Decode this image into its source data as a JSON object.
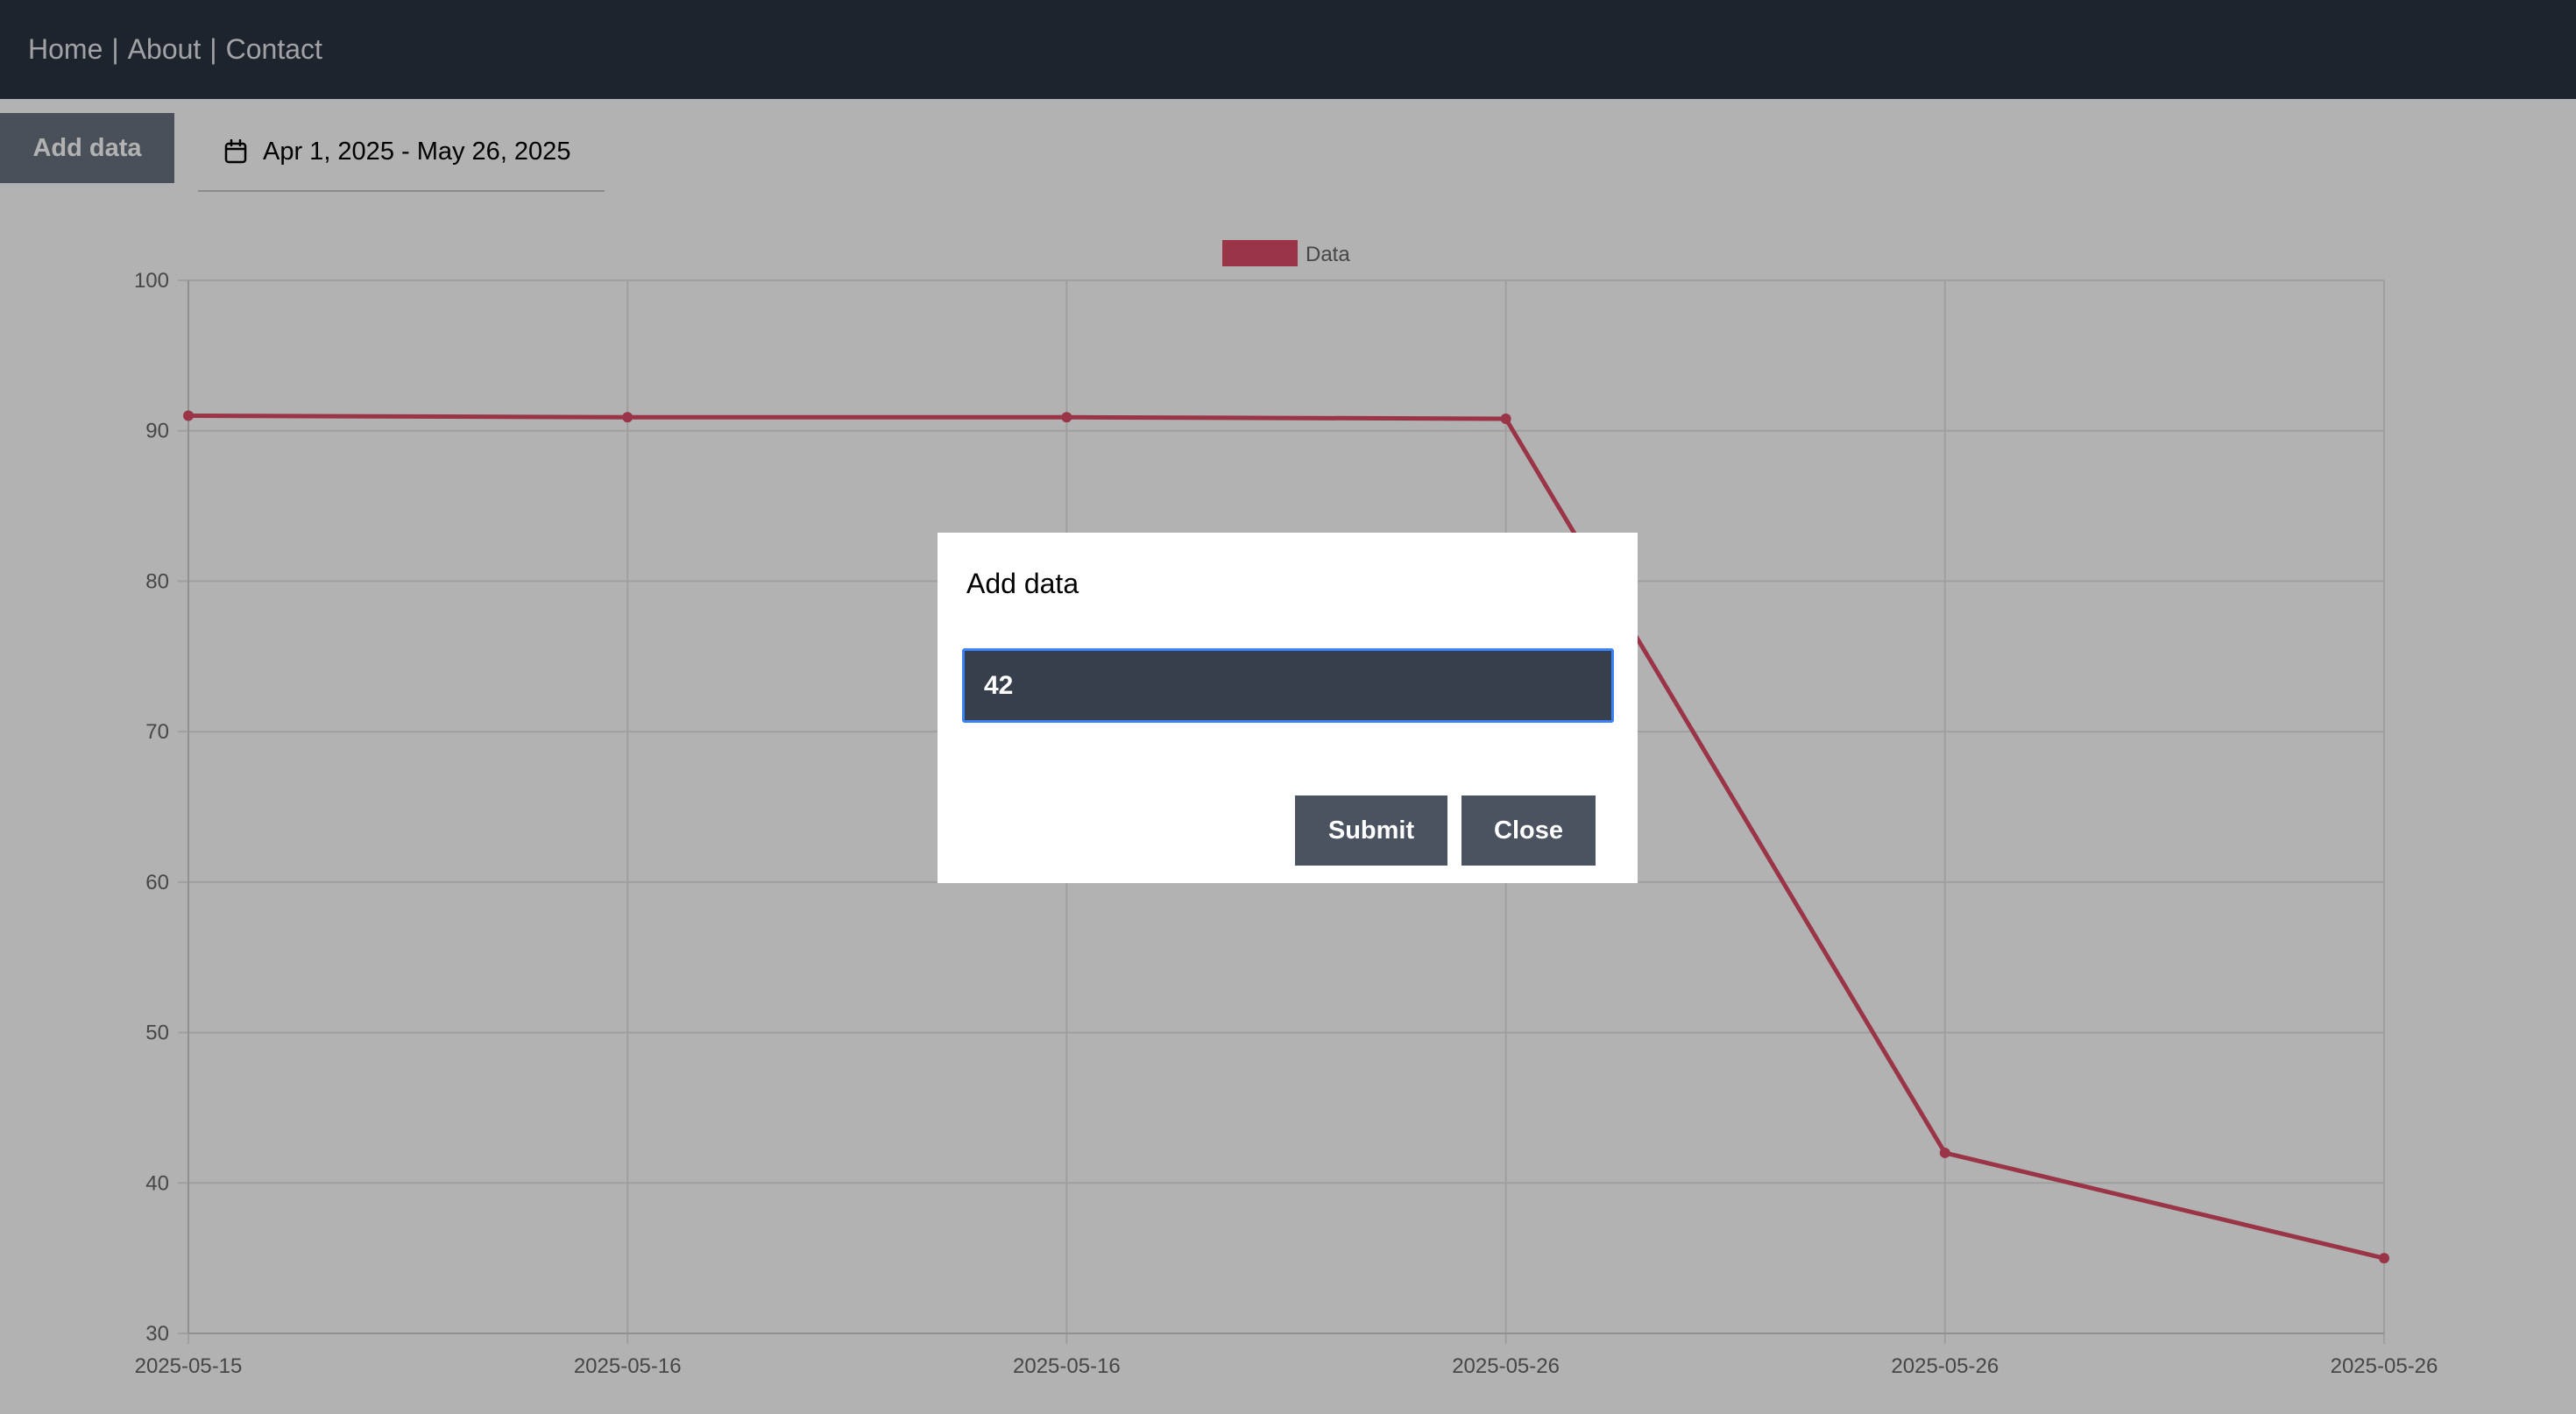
{
  "nav": {
    "links": [
      "Home",
      "About",
      "Contact"
    ],
    "separator": "|"
  },
  "toolbar": {
    "add_data_label": "Add data",
    "date_range": "Apr 1, 2025 - May 26, 2025",
    "date_icon": "calendar-icon"
  },
  "chart_data": {
    "type": "line",
    "title": "",
    "xlabel": "",
    "ylabel": "",
    "categories": [
      "2025-05-15",
      "2025-05-16",
      "2025-05-16",
      "2025-05-26",
      "2025-05-26",
      "2025-05-26"
    ],
    "series": [
      {
        "name": "Data",
        "values": [
          91,
          90.9,
          90.9,
          90.8,
          42,
          35
        ],
        "color": "#dd4c68"
      }
    ],
    "ylim": [
      30,
      100
    ],
    "yticks": [
      30,
      40,
      50,
      60,
      70,
      80,
      90,
      100
    ],
    "grid": true,
    "legend": "top-center"
  },
  "modal": {
    "title": "Add data",
    "input_value": "42",
    "submit_label": "Submit",
    "close_label": "Close"
  },
  "colors": {
    "navbar": "#2b3442",
    "series": "#dd4c68",
    "input_border": "#3b82f6",
    "button": "#4b5361"
  }
}
